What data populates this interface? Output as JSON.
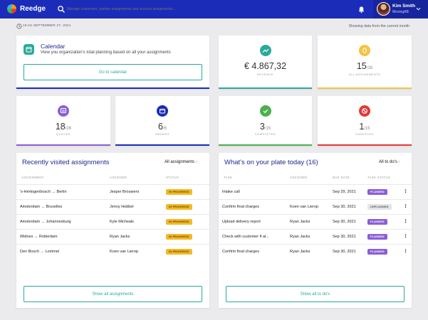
{
  "app": {
    "brand": "Reedge",
    "search_placeholder": "Manage customers, partner assignments and account assignments..."
  },
  "user": {
    "name": "Kim Smith",
    "org": "MovingAB"
  },
  "header": {
    "timestamp": "16:16 SEPTEMBER 27, 2021",
    "range": "Showing data from the current month"
  },
  "calendar": {
    "title": "Calendar",
    "description": "View you organization's total planning based on all your assignments",
    "button": "Go to calendar",
    "accent": "#2aaa9a"
  },
  "kpis": [
    {
      "value": "€ 4.867,32",
      "total": "",
      "label": "REVENUE",
      "color": "#2aaa9a",
      "icon": "trend-icon"
    },
    {
      "value": "15",
      "total": "16",
      "label": "ALL ASSIGNMENTS",
      "color": "#f5c342",
      "icon": "coin-icon"
    },
    {
      "value": "18",
      "total": "26",
      "label": "QUOTES",
      "color": "#8b5fd6",
      "icon": "quote-icon"
    },
    {
      "value": "6",
      "total": "6",
      "label": "ORDERS",
      "color": "#1a2cb8",
      "icon": "orders-icon"
    },
    {
      "value": "3",
      "total": "15",
      "label": "COMPLETED",
      "color": "#4caf50",
      "icon": "check-icon"
    },
    {
      "value": "1",
      "total": "15",
      "label": "CANCELED",
      "color": "#e53935",
      "icon": "cancel-icon"
    }
  ],
  "recent": {
    "title": "Recently visited assignments",
    "link": "All assignments",
    "columns": [
      "ASSIGNMENT",
      "ASSIGNEE",
      "STATUS"
    ],
    "rows": [
      {
        "assignment": "'s-Hertogenbosch → Berlin",
        "assignee": "Jesper Brouwers",
        "status": "IN PROGRESS"
      },
      {
        "assignment": "Amsterdam → Bruxelles",
        "assignee": "Jenny Hobbel",
        "status": "IN PROGRESS"
      },
      {
        "assignment": "Amsterdam → Johannesburg",
        "assignee": "Kyle Micheals",
        "status": "IN PROGRESS"
      },
      {
        "assignment": "Widnes → Rotterdam",
        "assignee": "Ryan Jacks",
        "status": "IN PROGRESS"
      },
      {
        "assignment": "Den Bosch → Lommel",
        "assignee": "Koen van Lierop",
        "status": "IN PROGRESS"
      }
    ],
    "button": "Show all assignments"
  },
  "todo": {
    "title": "What's on your plate today (16)",
    "link": "All to do's",
    "columns": [
      "TASK",
      "ASSIGNEE",
      "DUE DATE",
      "TASK STATUS"
    ],
    "rows": [
      {
        "task": "Intake call",
        "assignee": "",
        "due": "Sep 29, 2021",
        "status": "PLANNED"
      },
      {
        "task": "Confirm final charges",
        "assignee": "Koen van Lierop",
        "due": "Sep 30, 2021",
        "status": "UNPLANNED"
      },
      {
        "task": "Upload delivery report",
        "assignee": "Ryan Jacks",
        "due": "Sep 30, 2021",
        "status": "PLANNED"
      },
      {
        "task": "Check with customer if al...",
        "assignee": "Ryan Jacks",
        "due": "Sep 30, 2021",
        "status": "PLANNED"
      },
      {
        "task": "Confirm final charges",
        "assignee": "Ryan Jacks",
        "due": "Sep 30, 2021",
        "status": "PLANNED"
      }
    ],
    "button": "Show all to do's"
  }
}
